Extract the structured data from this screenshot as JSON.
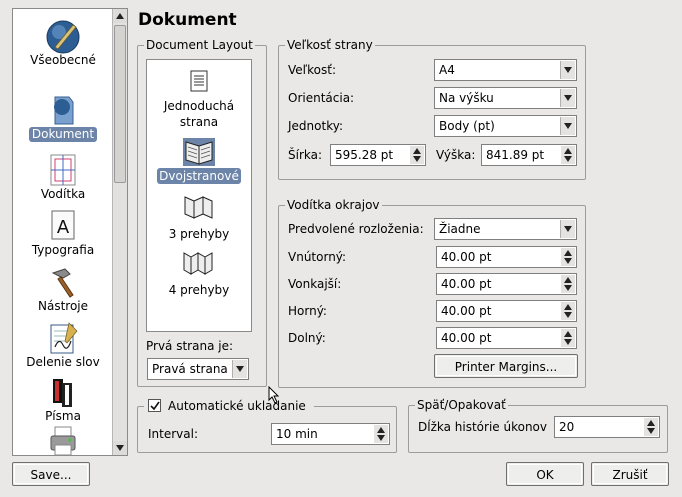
{
  "page_title": "Dokument",
  "sidebar": {
    "items": [
      {
        "label": "Všeobecné",
        "icon": "general-icon"
      },
      {
        "label": "Dokument",
        "icon": "document-icon"
      },
      {
        "label": "Vodítka",
        "icon": "guides-icon"
      },
      {
        "label": "Typografia",
        "icon": "typography-icon"
      },
      {
        "label": "Nástroje",
        "icon": "tools-icon"
      },
      {
        "label": "Delenie slov",
        "icon": "hyphenator-icon"
      },
      {
        "label": "Písma",
        "icon": "fonts-icon"
      },
      {
        "label": "",
        "icon": "printer-icon"
      }
    ],
    "selected": "Dokument"
  },
  "document_layout": {
    "legend": "Document Layout",
    "items": [
      {
        "label": "Jednoduchá strana",
        "line1": "Jednoduchá",
        "line2": "strana",
        "icon": "single-page-icon"
      },
      {
        "label": "Dvojstranové",
        "icon": "double-sided-icon"
      },
      {
        "label": "3 prehyby",
        "icon": "3-fold-icon"
      },
      {
        "label": "4 prehyby",
        "icon": "4-fold-icon"
      }
    ],
    "selected": "Dvojstranové",
    "first_page_label": "Prvá strana je:",
    "first_page_value": "Pravá strana"
  },
  "page_size": {
    "legend": "Veľkosť strany",
    "size_label": "Veľkosť:",
    "size_value": "A4",
    "orientation_label": "Orientácia:",
    "orientation_value": "Na výšku",
    "units_label": "Jednotky:",
    "units_value": "Body (pt)",
    "width_label": "Šírka:",
    "width_value": "595.28 pt",
    "height_label": "Výška:",
    "height_value": "841.89 pt"
  },
  "margin_guides": {
    "legend": "Vodítka okrajov",
    "preset_label": "Predvolené rozloženia:",
    "preset_value": "Žiadne",
    "inside_label": "Vnútorný:",
    "inside_value": "40.00 pt",
    "outside_label": "Vonkajší:",
    "outside_value": "40.00 pt",
    "top_label": "Horný:",
    "top_value": "40.00 pt",
    "bottom_label": "Dolný:",
    "bottom_value": "40.00 pt",
    "printer_margins_button": "Printer Margins..."
  },
  "autosave": {
    "legend": "Automatické ukladanie",
    "checked": true,
    "interval_label": "Interval:",
    "interval_value": "10 min"
  },
  "undo_redo": {
    "legend": "Späť/Opakovať",
    "history_label": "Dĺžka histórie úkonov",
    "history_value": "20"
  },
  "buttons": {
    "save": "Save...",
    "ok": "OK",
    "cancel": "Zrušiť"
  },
  "colors": {
    "selection": "#6b84a8",
    "background": "#e9e8e6"
  }
}
